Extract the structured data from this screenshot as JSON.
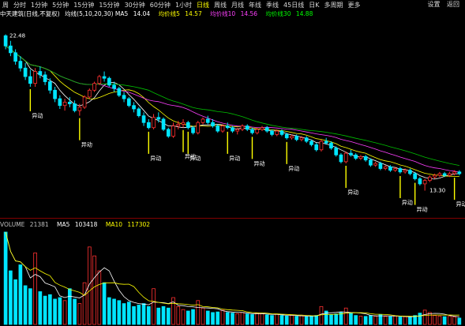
{
  "toolbar": {
    "items": [
      "周",
      "分时",
      "1分钟",
      "5分钟",
      "15分钟",
      "15分钟",
      "30分钟",
      "60分钟",
      "1小时",
      "日线",
      "周线",
      "月线",
      "年线",
      "季线",
      "45日线",
      "日K",
      "多周期",
      "更多"
    ],
    "active_index": 9,
    "right": [
      "设置",
      "返回"
    ]
  },
  "ma_bar": {
    "title": "中天建筑(日线,不复权)",
    "items": [
      {
        "label": "均线(5,10,20,30) MA5",
        "value": "14.04",
        "color": "#ffffff"
      },
      {
        "label": "均价线5",
        "value": "14.57",
        "color": "#ffff00"
      },
      {
        "label": "均价线10",
        "value": "14.56",
        "color": "#ff40ff"
      },
      {
        "label": "均价线30",
        "value": "14.88",
        "color": "#00ff00"
      }
    ]
  },
  "price_labels": {
    "high": "22.48",
    "low": "13.30"
  },
  "event_label": "异动",
  "vol_bar": {
    "items": [
      {
        "label": "VOLUME",
        "value": "21381",
        "color": "#c0c0c0"
      },
      {
        "label": "MA5",
        "value": "103418",
        "color": "#ffffff"
      },
      {
        "label": "MA10",
        "value": "117302",
        "color": "#ffff00"
      }
    ]
  },
  "colors": {
    "up": "#ff3030",
    "down": "#00e5ff",
    "ma5": "#ffffff",
    "ma10": "#ffff00",
    "ma20": "#ff40ff",
    "ma30": "#00c000",
    "event": "#ffff00"
  },
  "chart_data": {
    "type": "candlestick",
    "grid": false,
    "ylim": [
      13.0,
      23.2
    ],
    "ohlc": [
      [
        22.4,
        22.48,
        21.6,
        21.8
      ],
      [
        21.8,
        22.1,
        21.2,
        21.4
      ],
      [
        21.4,
        21.6,
        20.7,
        20.9
      ],
      [
        20.9,
        21.2,
        20.3,
        20.5
      ],
      [
        20.5,
        20.8,
        19.8,
        20.0
      ],
      [
        20.0,
        20.4,
        19.4,
        19.6
      ],
      [
        19.6,
        20.5,
        19.4,
        20.3
      ],
      [
        20.3,
        20.6,
        19.9,
        20.1
      ],
      [
        20.1,
        20.3,
        19.5,
        19.7
      ],
      [
        19.7,
        19.9,
        19.0,
        19.2
      ],
      [
        19.2,
        19.4,
        18.5,
        18.7
      ],
      [
        18.7,
        18.9,
        18.1,
        18.3
      ],
      [
        18.3,
        18.7,
        18.0,
        18.5
      ],
      [
        18.5,
        18.8,
        18.2,
        18.4
      ],
      [
        18.4,
        18.6,
        17.9,
        18.0
      ],
      [
        18.0,
        18.4,
        17.7,
        18.2
      ],
      [
        18.2,
        18.9,
        18.1,
        18.8
      ],
      [
        18.8,
        19.3,
        18.7,
        19.2
      ],
      [
        19.2,
        19.7,
        19.1,
        19.6
      ],
      [
        19.6,
        20.1,
        19.5,
        20.0
      ],
      [
        20.0,
        20.3,
        19.7,
        19.9
      ],
      [
        19.9,
        20.0,
        19.4,
        19.5
      ],
      [
        19.5,
        19.7,
        19.1,
        19.3
      ],
      [
        19.3,
        19.4,
        18.8,
        18.9
      ],
      [
        18.9,
        19.1,
        18.5,
        18.7
      ],
      [
        18.7,
        18.8,
        18.2,
        18.3
      ],
      [
        18.3,
        18.5,
        17.9,
        18.1
      ],
      [
        18.1,
        18.2,
        17.6,
        17.7
      ],
      [
        17.7,
        17.9,
        17.1,
        17.3
      ],
      [
        17.3,
        17.5,
        16.9,
        17.0
      ],
      [
        17.0,
        17.8,
        16.9,
        17.6
      ],
      [
        17.6,
        17.9,
        17.3,
        17.5
      ],
      [
        17.5,
        17.6,
        16.8,
        16.9
      ],
      [
        16.9,
        17.0,
        16.4,
        16.5
      ],
      [
        16.5,
        17.3,
        16.4,
        17.1
      ],
      [
        17.1,
        17.4,
        16.9,
        17.2
      ],
      [
        17.2,
        17.5,
        17.0,
        17.3
      ],
      [
        17.3,
        17.4,
        16.9,
        17.0
      ],
      [
        17.0,
        17.1,
        16.6,
        16.7
      ],
      [
        16.7,
        17.4,
        16.6,
        17.3
      ],
      [
        17.3,
        17.6,
        17.2,
        17.5
      ],
      [
        17.5,
        17.7,
        17.2,
        17.3
      ],
      [
        17.3,
        17.5,
        17.0,
        17.1
      ],
      [
        17.1,
        17.2,
        16.7,
        16.8
      ],
      [
        16.8,
        17.2,
        16.7,
        17.1
      ],
      [
        17.1,
        17.3,
        16.9,
        17.0
      ],
      [
        17.0,
        17.1,
        16.7,
        16.8
      ],
      [
        16.8,
        17.0,
        16.6,
        16.9
      ],
      [
        16.9,
        17.2,
        16.8,
        17.1
      ],
      [
        17.1,
        17.2,
        16.8,
        16.9
      ],
      [
        16.9,
        17.0,
        16.6,
        16.7
      ],
      [
        16.7,
        17.0,
        16.6,
        16.9
      ],
      [
        16.9,
        17.1,
        16.8,
        17.0
      ],
      [
        17.0,
        17.1,
        16.7,
        16.8
      ],
      [
        16.8,
        16.9,
        16.5,
        16.6
      ],
      [
        16.6,
        16.9,
        16.5,
        16.8
      ],
      [
        16.8,
        16.9,
        16.5,
        16.6
      ],
      [
        16.6,
        16.7,
        16.3,
        16.4
      ],
      [
        16.4,
        16.6,
        16.3,
        16.5
      ],
      [
        16.5,
        16.6,
        16.2,
        16.3
      ],
      [
        16.3,
        16.5,
        16.2,
        16.4
      ],
      [
        16.4,
        16.5,
        16.1,
        16.2
      ],
      [
        16.2,
        16.3,
        15.9,
        16.0
      ],
      [
        16.0,
        16.1,
        15.6,
        15.7
      ],
      [
        15.7,
        16.3,
        15.6,
        16.2
      ],
      [
        16.2,
        16.4,
        16.0,
        16.1
      ],
      [
        16.1,
        16.2,
        15.7,
        15.8
      ],
      [
        15.8,
        15.9,
        15.3,
        15.4
      ],
      [
        15.4,
        15.5,
        14.9,
        15.0
      ],
      [
        15.0,
        15.6,
        14.9,
        15.5
      ],
      [
        15.5,
        15.7,
        15.3,
        15.4
      ],
      [
        15.4,
        15.5,
        15.1,
        15.2
      ],
      [
        15.2,
        15.4,
        15.1,
        15.3
      ],
      [
        15.3,
        15.4,
        15.0,
        15.1
      ],
      [
        15.1,
        15.2,
        14.7,
        14.8
      ],
      [
        14.8,
        15.0,
        14.7,
        14.9
      ],
      [
        14.9,
        15.0,
        14.5,
        14.6
      ],
      [
        14.6,
        14.8,
        14.5,
        14.7
      ],
      [
        14.7,
        14.8,
        14.4,
        14.5
      ],
      [
        14.5,
        14.7,
        14.4,
        14.6
      ],
      [
        14.6,
        14.7,
        14.3,
        14.4
      ],
      [
        14.4,
        14.6,
        14.3,
        14.5
      ],
      [
        14.5,
        14.6,
        14.2,
        14.3
      ],
      [
        14.3,
        14.4,
        13.9,
        14.0
      ],
      [
        14.0,
        14.1,
        13.6,
        13.7
      ],
      [
        13.7,
        14.0,
        13.3,
        13.9
      ],
      [
        13.9,
        14.2,
        13.8,
        14.1
      ],
      [
        14.1,
        14.3,
        14.0,
        14.2
      ],
      [
        14.2,
        14.4,
        14.1,
        14.3
      ],
      [
        14.3,
        14.4,
        14.1,
        14.2
      ],
      [
        14.2,
        14.4,
        14.1,
        14.3
      ],
      [
        14.3,
        14.5,
        14.2,
        14.4
      ],
      [
        14.4,
        14.5,
        14.2,
        14.3
      ]
    ],
    "volume": [
      310000,
      180000,
      150000,
      200000,
      130000,
      120000,
      240000,
      110000,
      95000,
      100000,
      85000,
      90000,
      80000,
      120000,
      85000,
      70000,
      140000,
      260000,
      230000,
      180000,
      140000,
      90000,
      85000,
      80000,
      70000,
      75000,
      60000,
      65000,
      70000,
      60000,
      120000,
      55000,
      60000,
      55000,
      90000,
      60000,
      50000,
      45000,
      50000,
      80000,
      55000,
      45000,
      40000,
      42000,
      48000,
      40000,
      38000,
      36000,
      40000,
      35000,
      33000,
      38000,
      36000,
      32000,
      30000,
      34000,
      30000,
      28000,
      30000,
      27000,
      29000,
      26000,
      28000,
      30000,
      60000,
      45000,
      32000,
      35000,
      40000,
      55000,
      38000,
      30000,
      28000,
      27000,
      30000,
      28000,
      32000,
      27000,
      26000,
      28000,
      25000,
      26000,
      24000,
      30000,
      38000,
      48000,
      40000,
      30000,
      28000,
      26000,
      27000,
      25000,
      21381
    ],
    "events": [
      5,
      15,
      29,
      36,
      37,
      45,
      50,
      57,
      69,
      80,
      83,
      91
    ]
  }
}
